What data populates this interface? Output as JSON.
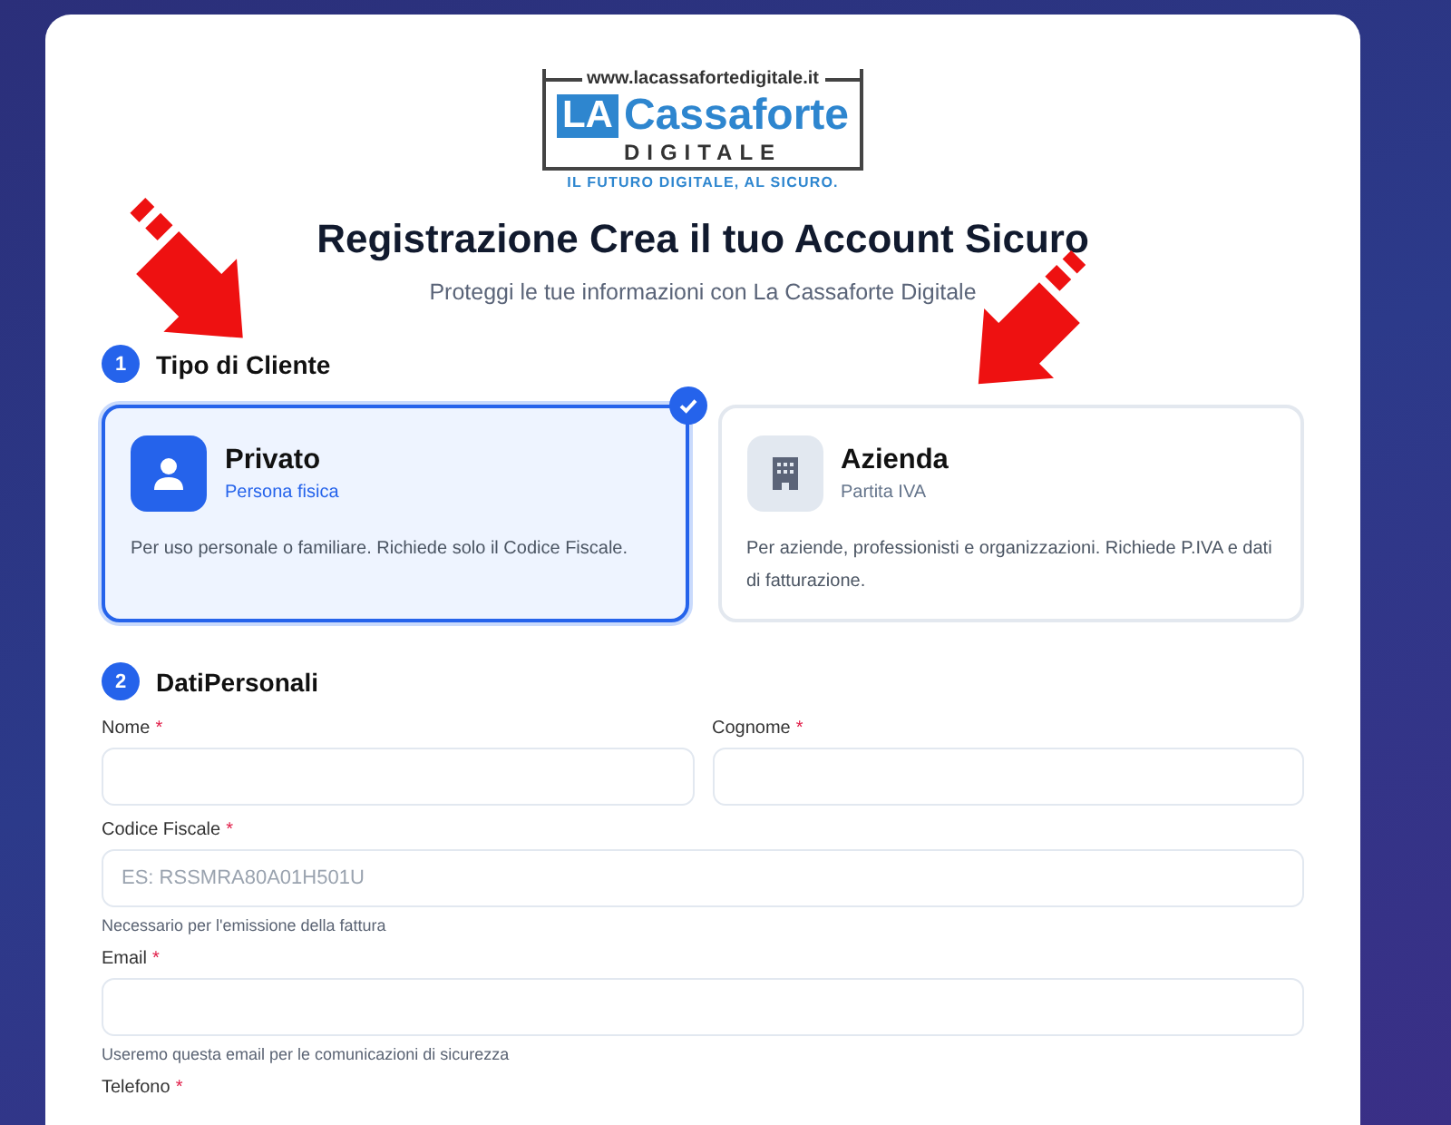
{
  "logo": {
    "url": "www.lacassafortedigitale.it",
    "badge": "LA",
    "name": "Cassaforte",
    "subname": "DIGITALE",
    "tagline": "IL FUTURO DIGITALE, AL SICURO."
  },
  "title": "Registrazione Crea il tuo Account Sicuro",
  "subtitle": "Proteggi le tue informazioni con La Cassaforte Digitale",
  "sections": [
    {
      "number": "1",
      "title": "Tipo di Cliente"
    },
    {
      "number": "2",
      "title": "DatiPersonali"
    }
  ],
  "client_types": [
    {
      "kind": "person",
      "title": "Privato",
      "subtitle": "Persona fisica",
      "description": "Per uso personale o familiare. Richiede solo il Codice Fiscale.",
      "selected": true
    },
    {
      "kind": "building",
      "title": "Azienda",
      "subtitle": "Partita IVA",
      "description": "Per aziende, professionisti e organizzazioni. Richiede P.IVA e dati di fatturazione.",
      "selected": false
    }
  ],
  "field_rows": [
    [
      {
        "label": "Nome",
        "mark": "*"
      },
      {
        "label": "Cognome",
        "mark": "*"
      }
    ],
    [
      {
        "label": "Codice Fiscale",
        "mark": "*",
        "placeholder": "ES: RSSMRA80A01H501U",
        "help": "Necessario per l'emissione della fattura"
      }
    ],
    [
      {
        "label": "Email",
        "mark": "*",
        "help": "Useremo questa email per le comunicazioni di sicurezza"
      }
    ]
  ],
  "last_label": {
    "label": "Telefono",
    "mark": "*"
  }
}
